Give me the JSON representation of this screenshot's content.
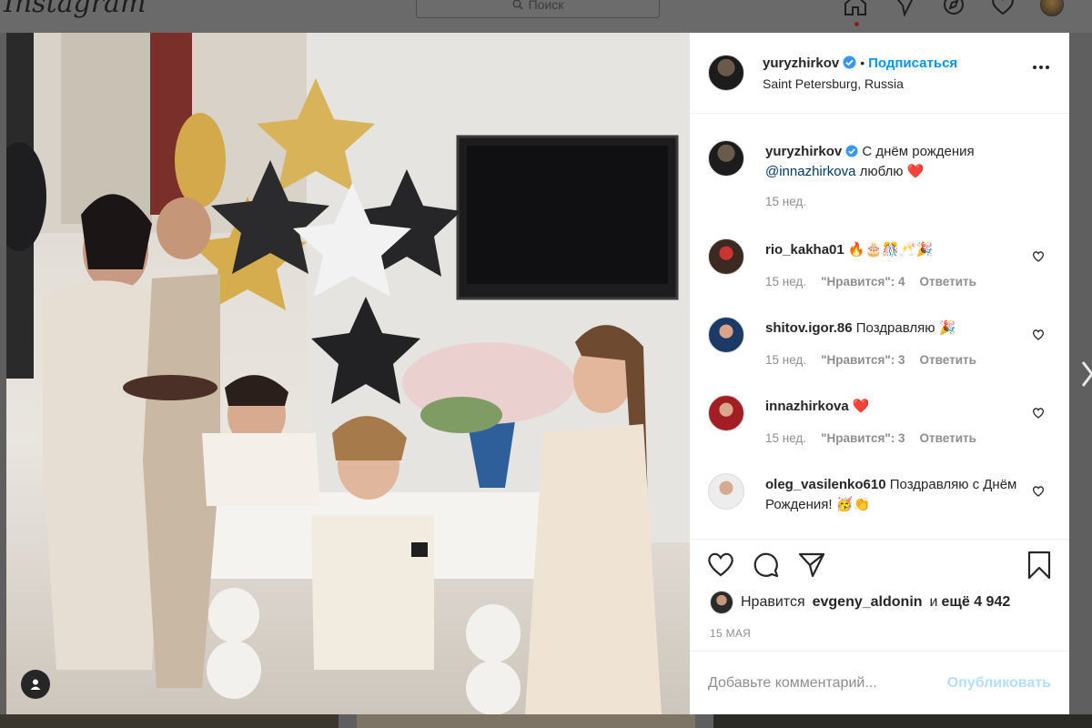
{
  "app": {
    "logo": "Instagram",
    "search_placeholder": "Поиск"
  },
  "post": {
    "author": {
      "username": "yuryzhirkov",
      "verified": true,
      "follow_label": "Подписаться",
      "location": "Saint Petersburg, Russia"
    },
    "caption": {
      "username": "yuryzhirkov",
      "text": "С днём рождения",
      "mention": "@innazhirkova",
      "text_after": "люблю",
      "emoji": "❤️",
      "time": "15 нед."
    },
    "comments": [
      {
        "username": "rio_kakha01",
        "text": "🔥🎂🎊🥂🎉",
        "time": "15 нед.",
        "likes": "\"Нравится\": 4",
        "reply": "Ответить"
      },
      {
        "username": "shitov.igor.86",
        "text": "Поздравляю 🎉",
        "time": "15 нед.",
        "likes": "\"Нравится\": 3",
        "reply": "Ответить"
      },
      {
        "username": "innazhirkova",
        "text": "❤️",
        "time": "15 нед.",
        "likes": "\"Нравится\": 3",
        "reply": "Ответить"
      },
      {
        "username": "oleg_vasilenko610",
        "text": "Поздравляю с Днём Рождения! 🥳👏"
      }
    ],
    "likes": {
      "prefix": "Нравится",
      "user": "evgeny_aldonin",
      "middle": "и",
      "count_text": "ещё 4 942"
    },
    "date": "15 МАЯ",
    "add_comment_placeholder": "Добавьте комментарий...",
    "publish_label": "Опубликовать"
  },
  "colors": {
    "accent": "#0095f6",
    "publish_disabled": "#b2dffc",
    "heart": "#ed4956",
    "overlay": "#5f5f5f"
  }
}
